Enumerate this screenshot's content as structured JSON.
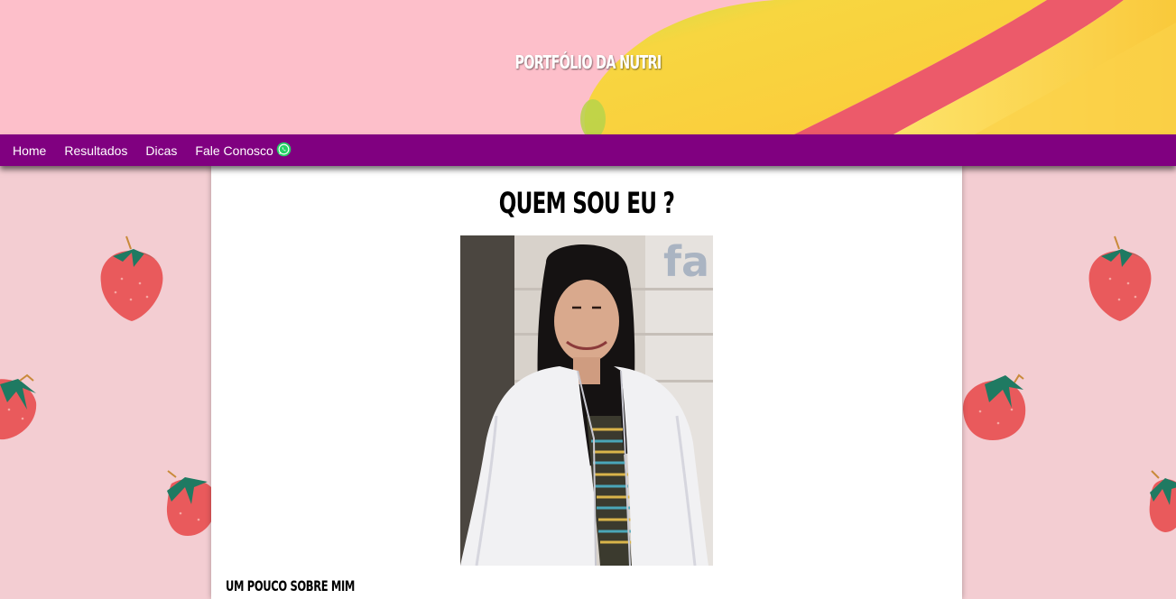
{
  "header": {
    "title": "PORTFÓLIO DA NUTRI"
  },
  "nav": {
    "items": [
      "Home",
      "Resultados",
      "Dicas",
      "Fale Conosco"
    ],
    "whatsapp_icon": "whatsapp-icon"
  },
  "main": {
    "title": "QUEM SOU EU ?",
    "subtitle": "UM POUCO SOBRE MIM"
  },
  "colors": {
    "nav_background": "#800080",
    "header_pink": "#fdbfca",
    "side_pink": "#f3cdd2",
    "banana_yellow": "#fdd24a",
    "strawberry_red": "#e95a5c",
    "leaf_green": "#1f7a62",
    "whatsapp_green": "#25d366"
  }
}
